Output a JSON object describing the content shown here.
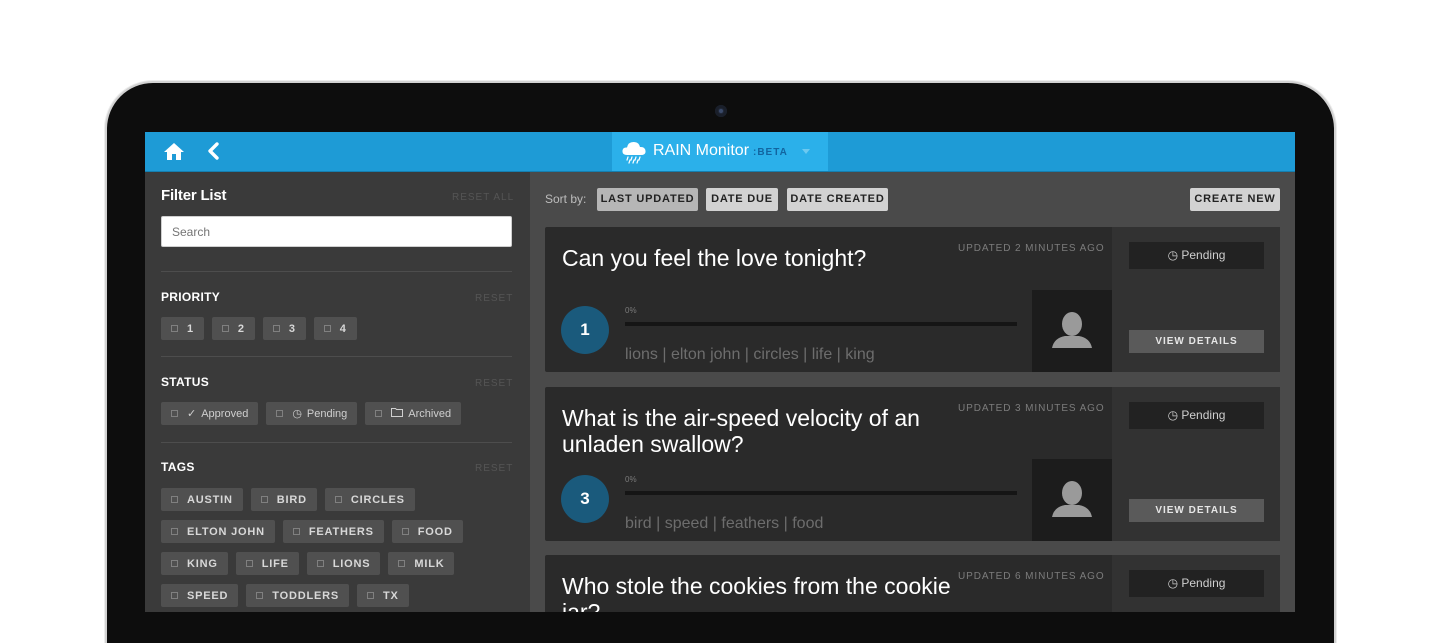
{
  "app": {
    "title": "RAIN Monitor",
    "beta": ":BETA"
  },
  "nav": {
    "home_icon": "home-icon",
    "back_icon": "chevron-left-icon"
  },
  "sidebar": {
    "title": "Filter List",
    "reset_all": "RESET ALL",
    "search_placeholder": "Search",
    "priority": {
      "title": "PRIORITY",
      "reset": "RESET",
      "items": [
        "1",
        "2",
        "3",
        "4"
      ]
    },
    "status": {
      "title": "STATUS",
      "reset": "RESET",
      "items": [
        {
          "label": "Approved",
          "icon": "check-icon"
        },
        {
          "label": "Pending",
          "icon": "clock-icon"
        },
        {
          "label": "Archived",
          "icon": "folder-icon"
        }
      ]
    },
    "tags": {
      "title": "TAGS",
      "reset": "RESET",
      "rows": [
        [
          "AUSTIN",
          "BIRD",
          "CIRCLES"
        ],
        [
          "ELTON JOHN",
          "FEATHERS",
          "FOOD"
        ],
        [
          "KING",
          "LIFE",
          "LIONS",
          "MILK"
        ],
        [
          "SPEED",
          "TODDLERS",
          "TX"
        ]
      ]
    }
  },
  "main": {
    "sort_label": "Sort by:",
    "sort_options": [
      "LAST UPDATED",
      "DATE DUE",
      "DATE CREATED"
    ],
    "sort_active": "LAST UPDATED",
    "create_new": "CREATE NEW",
    "cards": [
      {
        "question": "Can you feel the love tonight?",
        "updated": "UPDATED 2 MINUTES AGO",
        "status": "Pending",
        "priority": "1",
        "progress_label": "0%",
        "progress": 0,
        "tags": "lions | elton john | circles | life | king",
        "view": "VIEW DETAILS"
      },
      {
        "question": "What is the air-speed velocity of an unladen swallow?",
        "updated": "UPDATED 3 MINUTES AGO",
        "status": "Pending",
        "priority": "3",
        "progress_label": "0%",
        "progress": 0,
        "tags": "bird | speed | feathers | food",
        "view": "VIEW DETAILS"
      },
      {
        "question": "Who stole the cookies from the cookie jar?",
        "updated": "UPDATED 6 MINUTES AGO",
        "status": "Pending"
      }
    ]
  },
  "colors": {
    "accent": "#1e9bd6",
    "brand_bg": "#2bb0ea",
    "priority_circle": "#1a5a7c"
  }
}
